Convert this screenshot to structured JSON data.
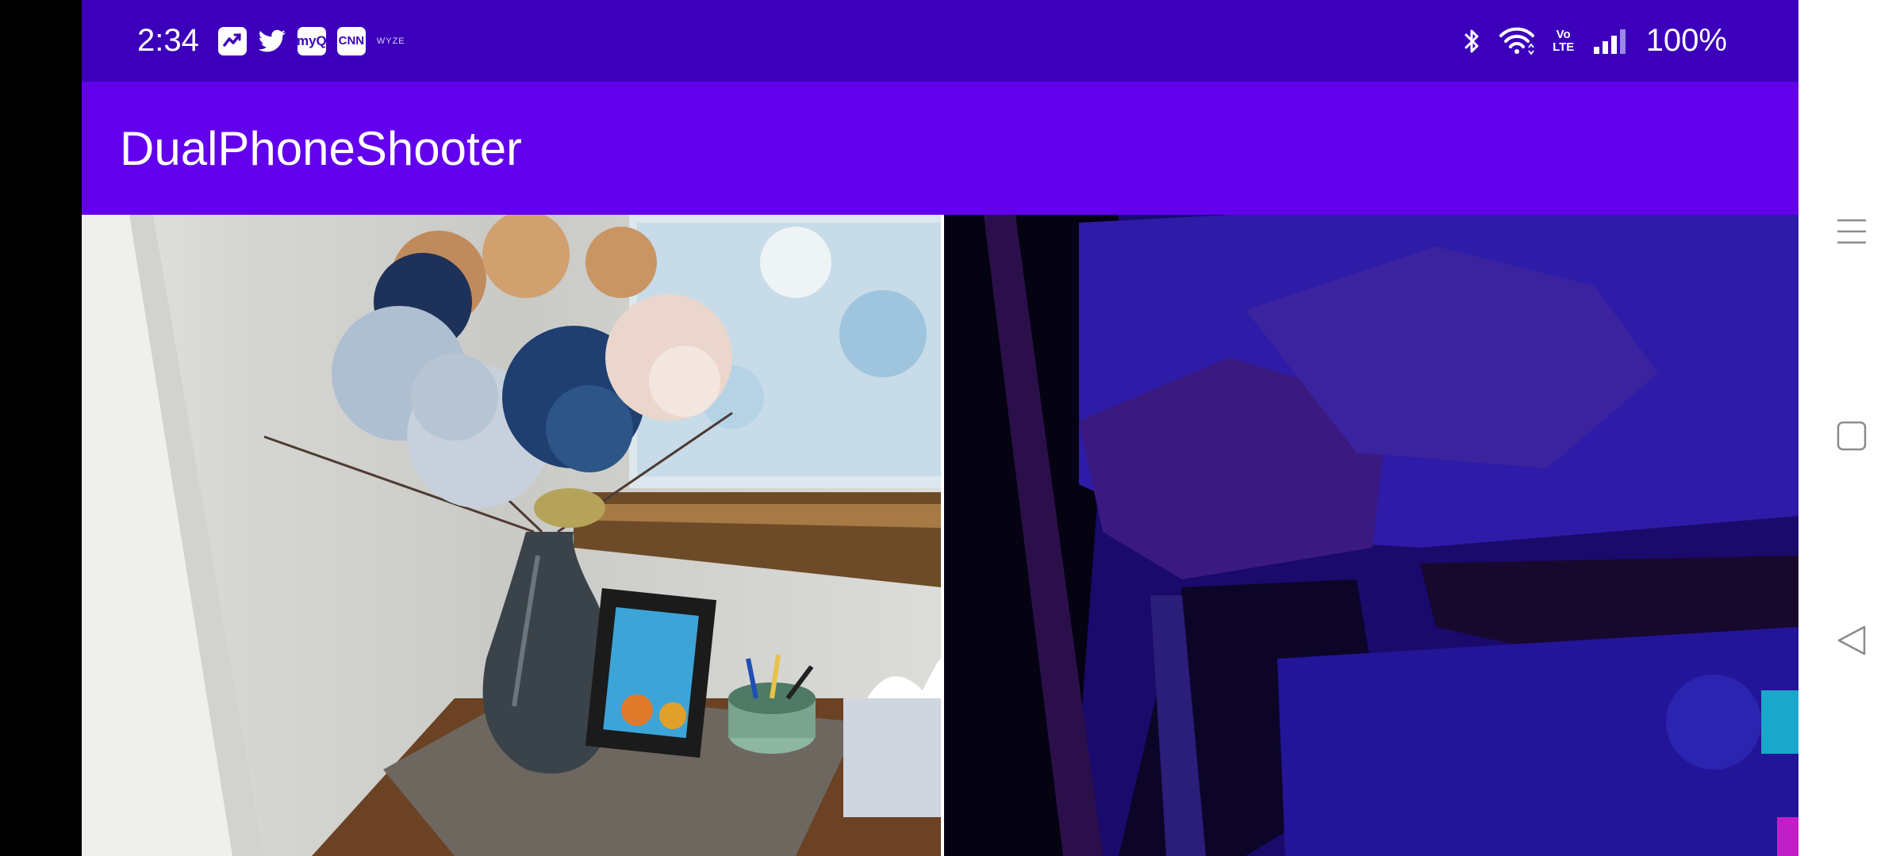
{
  "status_bar": {
    "time": "2:34",
    "notification_icons": [
      "activity-icon",
      "twitter-icon",
      "myq-icon",
      "cnn-icon",
      "wyze-icon"
    ],
    "myq_label": "myQ",
    "cnn_label": "CNN",
    "wyze_label": "WYZE",
    "volte_label": "Vo LTE",
    "battery": "100%"
  },
  "app_bar": {
    "title": "DualPhoneShooter",
    "color": "#6200ee"
  },
  "status_bar_color": "#3c00bb",
  "previews": {
    "left": "camera-preview",
    "right": "depth-preview"
  },
  "nav_bar": {
    "buttons": [
      "recent-apps",
      "home",
      "back"
    ]
  }
}
